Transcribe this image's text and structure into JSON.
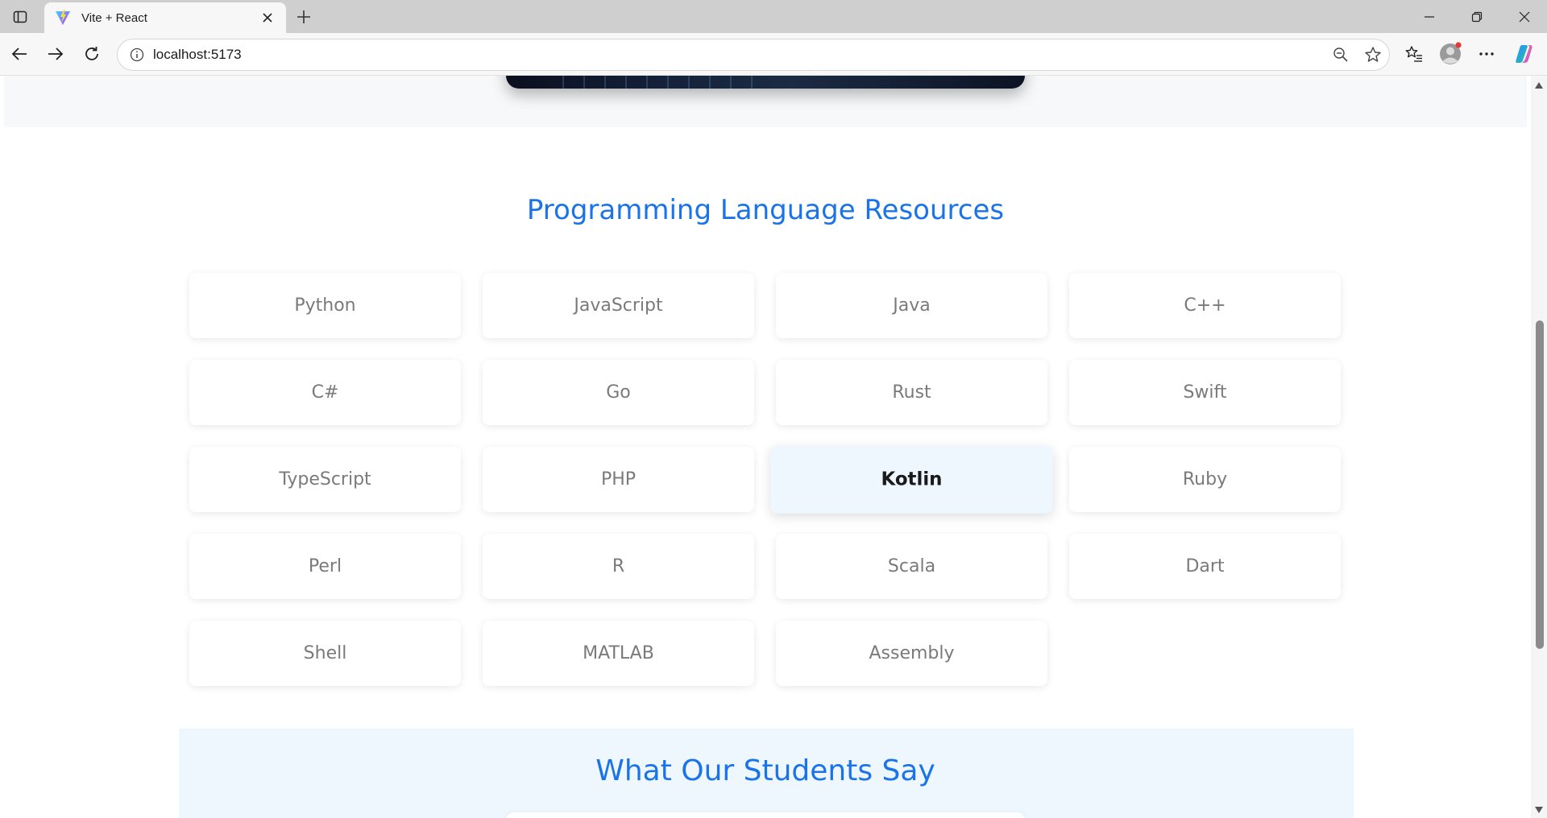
{
  "browser": {
    "tab_title": "Vite + React",
    "url": "localhost:5173"
  },
  "page": {
    "languages_title": "Programming Language Resources",
    "languages": [
      "Python",
      "JavaScript",
      "Java",
      "C++",
      "C#",
      "Go",
      "Rust",
      "Swift",
      "TypeScript",
      "PHP",
      "Kotlin",
      "Ruby",
      "Perl",
      "R",
      "Scala",
      "Dart",
      "Shell",
      "MATLAB",
      "Assembly"
    ],
    "active_language": "Kotlin",
    "testimonials_title": "What Our Students Say"
  },
  "colors": {
    "accent": "#1a73e8",
    "card_text": "#7a7a7a",
    "active_card_bg": "#eef6fe",
    "testimonials_bg": "#eef7fe"
  },
  "icons": {
    "tab_actions": "tab-actions-icon",
    "favicon": "vite-logo-icon",
    "tab_close": "close-icon",
    "new_tab": "plus-icon",
    "minimize": "minimize-icon",
    "restore": "restore-icon",
    "close_window": "close-icon",
    "back": "arrow-left-icon",
    "forward": "arrow-right-icon",
    "refresh": "refresh-icon",
    "site_info": "info-icon",
    "zoom": "zoom-out-icon",
    "favorite": "star-icon",
    "favorites": "favorites-list-icon",
    "profile": "profile-icon",
    "more": "more-icon",
    "copilot": "copilot-icon"
  }
}
